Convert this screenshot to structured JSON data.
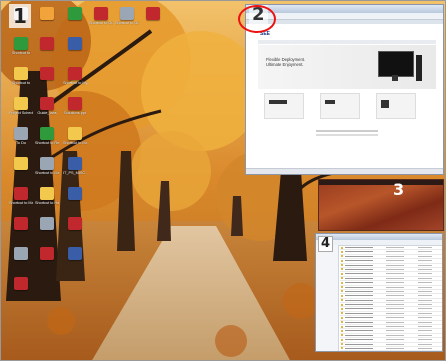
{
  "screen": {
    "badges": {
      "one": "1",
      "two": "2",
      "three": "3",
      "four": "4"
    }
  },
  "desktop_icons": [
    {
      "label": "",
      "color": "#d9d9d9"
    },
    {
      "label": "",
      "color": "#f2a33a"
    },
    {
      "label": "",
      "color": "#2e9a3c"
    },
    {
      "label": "Shortcut to Guide_uni...",
      "color": "#c0282d"
    },
    {
      "label": "Shortcut to Guide_uni...",
      "color": "#9aa6b3"
    },
    {
      "label": "",
      "color": "#c0282d"
    },
    {
      "label": "Shortcut to",
      "color": "#2e9a3c"
    },
    {
      "label": "",
      "color": "#c0282d"
    },
    {
      "label": "",
      "color": "#3a5da8"
    },
    {
      "label": "Shortcut to",
      "color": "#f2c94c"
    },
    {
      "label": "",
      "color": "#c0282d"
    },
    {
      "label": "Shortcut to My Documents (2)",
      "color": "#c0282d"
    },
    {
      "label": "Project Schedule",
      "color": "#f2c94c"
    },
    {
      "label": "Guide_labs",
      "color": "#c0282d"
    },
    {
      "label": "Solutions.ppt",
      "color": "#c0282d"
    },
    {
      "label": "To Do",
      "color": "#9aa6b3"
    },
    {
      "label": "Shortcut to Recycle",
      "color": "#2e9a3c"
    },
    {
      "label": "Shortcut to Manuals(v...)",
      "color": "#f2c94c"
    },
    {
      "label": "",
      "color": "#f2c94c"
    },
    {
      "label": "Shortcut to Manuals",
      "color": "#9aa6b3"
    },
    {
      "label": "IT_PS_MISC...",
      "color": "#3a5da8"
    },
    {
      "label": "Shortcut to Manuals_V...",
      "color": "#c0282d"
    },
    {
      "label": "Shortcut to Hdmi_38_2...",
      "color": "#f2c94c"
    },
    {
      "label": "",
      "color": "#3a5da8"
    },
    {
      "label": "",
      "color": "#c0282d"
    },
    {
      "label": "",
      "color": "#9aa6b3"
    },
    {
      "label": "",
      "color": "#c0282d"
    },
    {
      "label": "",
      "color": "#9aa6b3"
    },
    {
      "label": "",
      "color": "#c0282d"
    },
    {
      "label": "",
      "color": "#3a5da8"
    },
    {
      "label": "",
      "color": "#c0282d"
    }
  ],
  "browser": {
    "logo": "SEE",
    "hero_line1": "Flexible Deployment.",
    "hero_line2": "Ultimate Enjoyment."
  },
  "colors": {
    "annotation_ring": "#e11111",
    "wallpaper_leaves": "#d98a2a",
    "dunes": "#9c3e20"
  }
}
